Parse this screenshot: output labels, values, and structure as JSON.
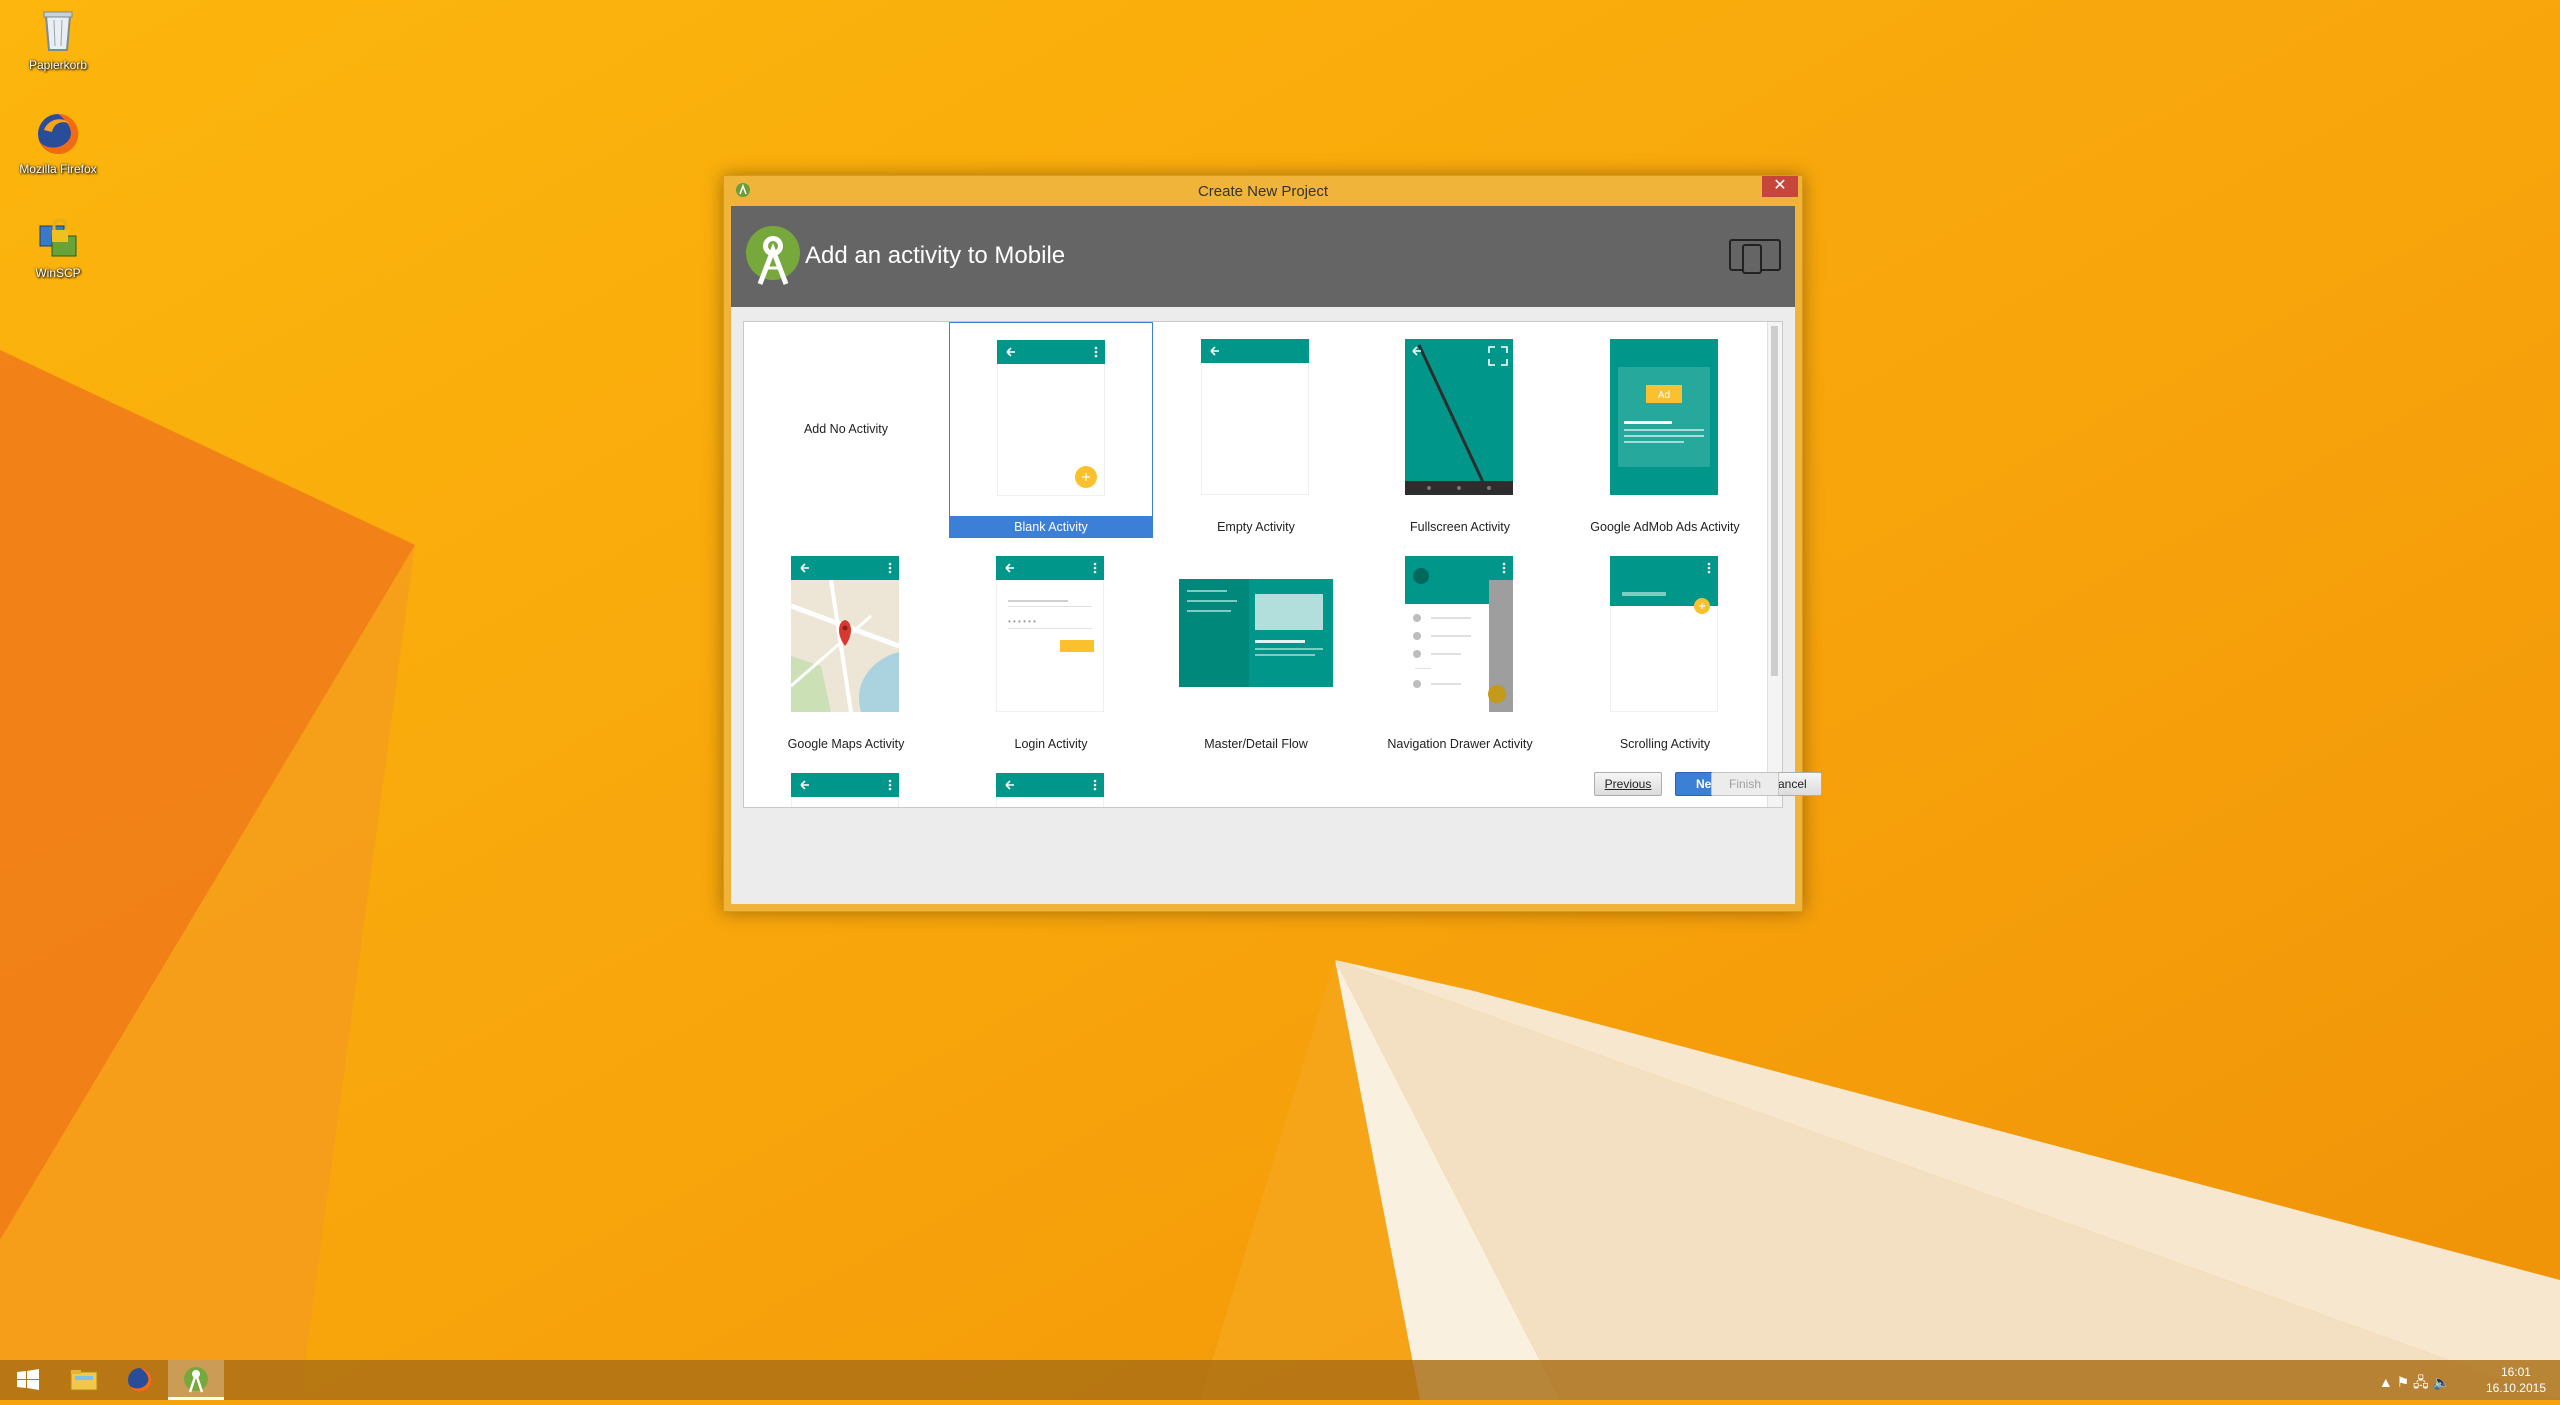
{
  "desktop": {
    "icons": [
      {
        "label": "Papierkorb"
      },
      {
        "label": "Mozilla Firefox"
      },
      {
        "label": "WinSCP"
      }
    ]
  },
  "window": {
    "title": "Create New Project",
    "close_glyph": "✕"
  },
  "header": {
    "title": "Add an activity to Mobile"
  },
  "gallery": {
    "tiles": [
      {
        "label": "Add No Activity"
      },
      {
        "label": "Blank Activity",
        "selected": true
      },
      {
        "label": "Empty Activity"
      },
      {
        "label": "Fullscreen Activity"
      },
      {
        "label": "Google AdMob Ads Activity",
        "badge": "Ad"
      },
      {
        "label": "Google Maps Activity"
      },
      {
        "label": "Login Activity"
      },
      {
        "label": "Master/Detail Flow"
      },
      {
        "label": "Navigation Drawer Activity"
      },
      {
        "label": "Scrolling Activity"
      }
    ]
  },
  "buttons": {
    "previous": "Previous",
    "next": "Next",
    "cancel": "Cancel",
    "finish": "Finish"
  },
  "taskbar": {
    "items": [
      "start",
      "file-explorer",
      "firefox",
      "android-studio"
    ],
    "tray_glyphs": "▲ ⚑ 🖧 🔈",
    "time": "16:01",
    "date": "16.10.2015"
  },
  "colors": {
    "teal": "#00968a",
    "accent_yellow": "#fbc02d",
    "selection_blue": "#3c7fd6",
    "header_gray": "#656565"
  }
}
